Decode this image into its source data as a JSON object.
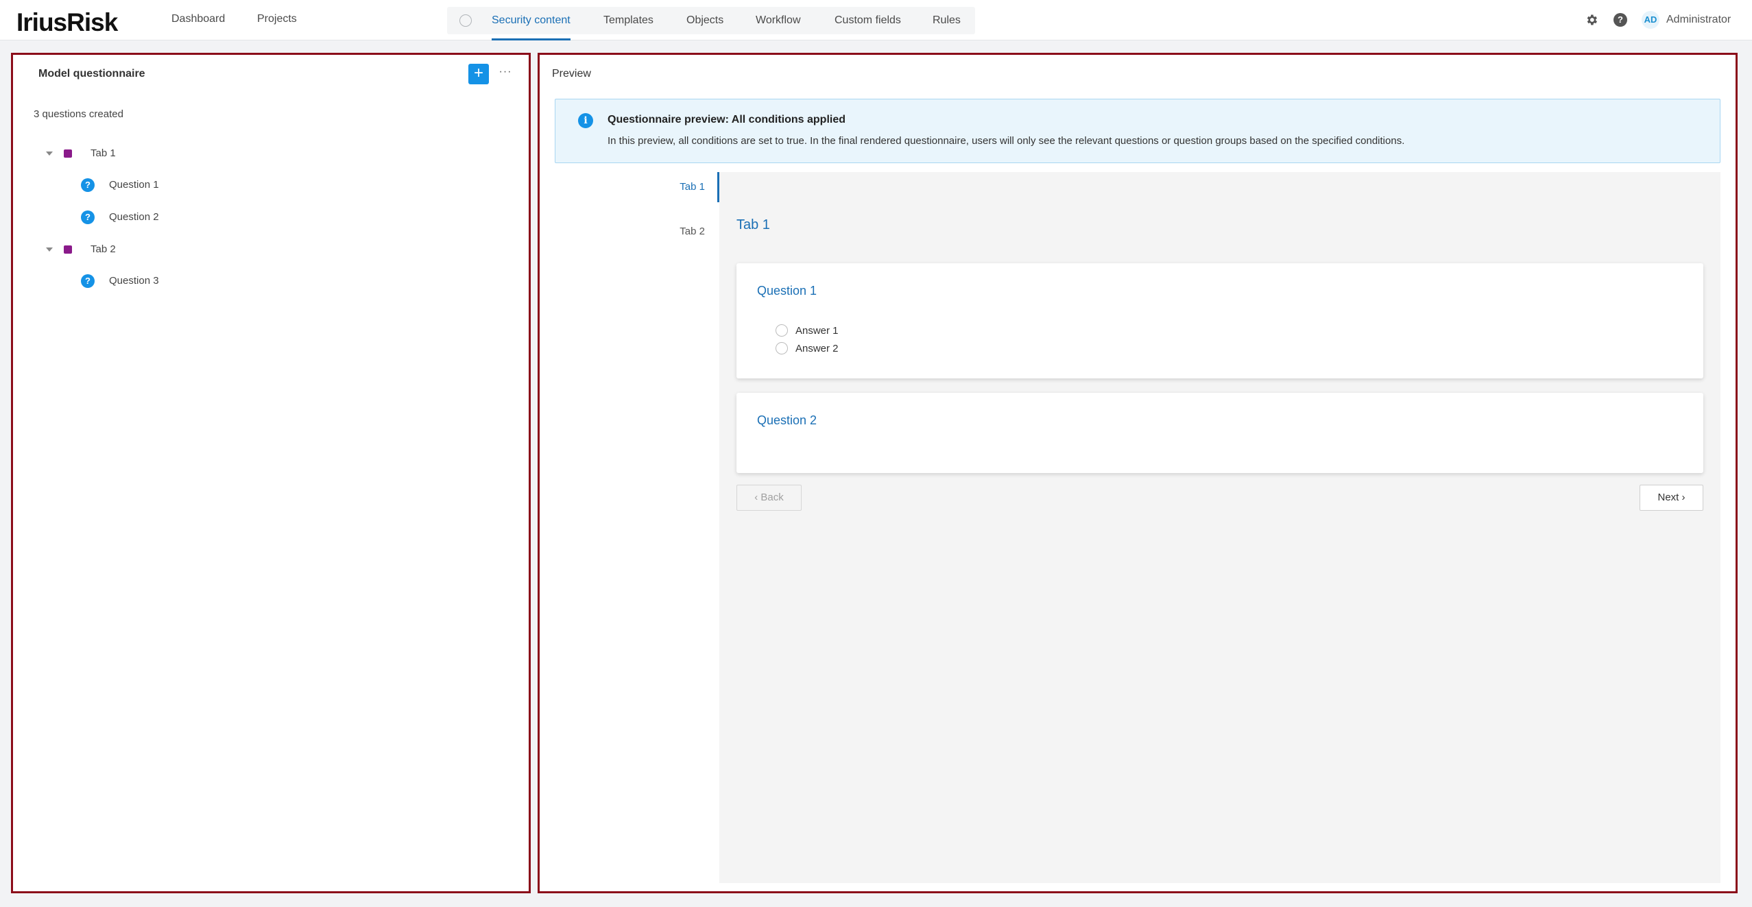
{
  "header": {
    "logo": "IriusRisk",
    "nav_left": [
      "Dashboard",
      "Projects"
    ],
    "nav_center": [
      "Security content",
      "Templates",
      "Objects",
      "Workflow",
      "Custom fields",
      "Rules"
    ],
    "active_nav": "Security content",
    "settings_icon": "gear-icon",
    "help_icon": "question-icon",
    "avatar_initials": "AD",
    "user_name": "Administrator"
  },
  "left_panel": {
    "title": "Model questionnaire",
    "add_label": "+",
    "more_label": "···",
    "count_text": "3 questions created",
    "tree": [
      {
        "label": "Tab 1",
        "questions": [
          "Question 1",
          "Question 2"
        ]
      },
      {
        "label": "Tab 2",
        "questions": [
          "Question 3"
        ]
      }
    ]
  },
  "preview": {
    "title": "Preview",
    "info_title": "Questionnaire preview: All conditions applied",
    "info_body": "In this preview, all conditions are set to true. In the final rendered questionnaire, users will only see the relevant questions or question groups based on the specified conditions.",
    "tabs": [
      "Tab 1",
      "Tab 2"
    ],
    "active_tab": "Tab 1",
    "heading": "Tab 1",
    "questions": [
      {
        "title": "Question 1",
        "answers": [
          "Answer 1",
          "Answer 2"
        ]
      },
      {
        "title": "Question 2",
        "answers": []
      }
    ],
    "back_label": "Back",
    "next_label": "Next"
  },
  "colors": {
    "accent": "#1592e6",
    "link": "#1a6fb5",
    "tab_marker": "#8a1a8a",
    "panel_border": "#8b0d1a"
  }
}
